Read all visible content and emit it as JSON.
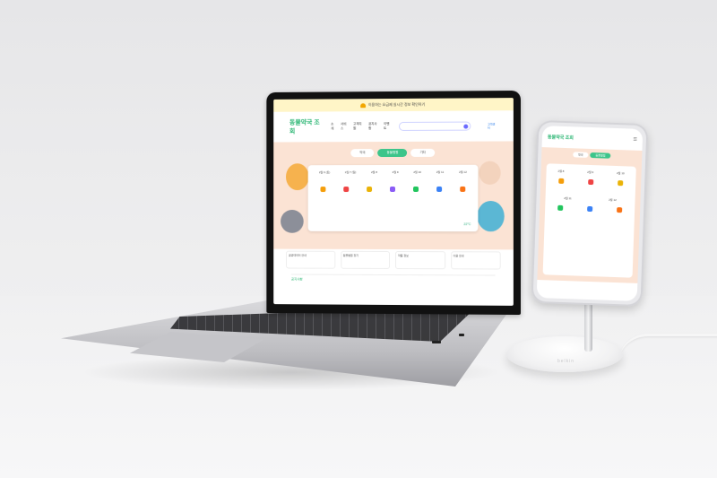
{
  "scene": {
    "notice_text": "이용하는 요금제 실시간 정보 확인하기",
    "site_logo": "동물약국 조회",
    "site_logo_badge": "",
    "nav_items": [
      "소개",
      "서비스",
      "고객지원",
      "공지사항",
      "이벤트"
    ],
    "search_placeholder": "",
    "cs_label": "고객센터",
    "tabs": [
      "약국",
      "동물병원",
      "기타"
    ],
    "dates": [
      "2월 6 (토)",
      "2월 7 (일)",
      "2월 8",
      "2월 9",
      "2월 10",
      "2월 11",
      "2월 12"
    ],
    "weather": "22°C",
    "cards": [
      "공공데이터 안내",
      "동물병원 찾기",
      "약품 정보",
      "이용 안내"
    ],
    "bottom_text": "공지사항",
    "phone_logo": "동물약국 조회",
    "stand_brand": "belkin"
  },
  "colors": {
    "accent_green": "#3cc58a",
    "hero_peach": "#fbe3d4",
    "notice_yellow": "#fff5c7",
    "icon_colors": [
      "#f59e0b",
      "#ef4444",
      "#eab308",
      "#8b5cf6",
      "#22c55e",
      "#3b82f6",
      "#f97316"
    ]
  }
}
